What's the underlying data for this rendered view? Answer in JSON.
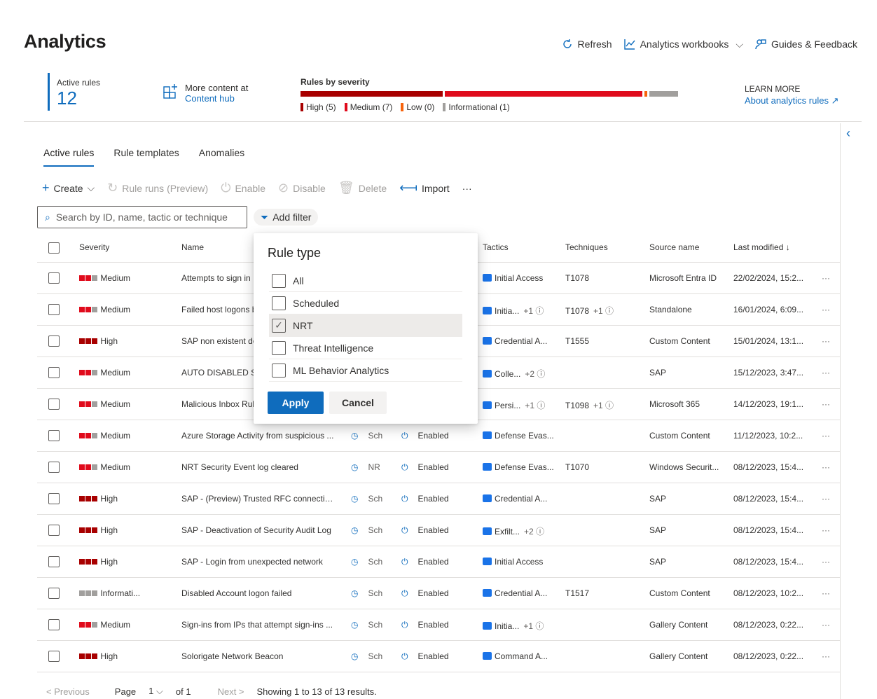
{
  "page": {
    "title": "Analytics"
  },
  "top_actions": {
    "refresh": "Refresh",
    "workbooks": "Analytics workbooks",
    "guides": "Guides & Feedback"
  },
  "summary": {
    "active_label": "Active rules",
    "active_count": "12",
    "content_line1": "More content at",
    "content_line2": "Content hub",
    "severity_label": "Rules by severity",
    "legend": {
      "high": "High (5)",
      "medium": "Medium (7)",
      "low": "Low (0)",
      "info": "Informational (1)"
    },
    "severity_counts": {
      "high": 5,
      "medium": 7,
      "low": 0,
      "informational": 1
    },
    "colors": {
      "high": "#a80000",
      "medium": "#e00b1c",
      "low": "#f7630c",
      "info": "#a19f9d"
    },
    "learn_more": "LEARN MORE",
    "learn_link": "About analytics rules"
  },
  "tabs": [
    "Active rules",
    "Rule templates",
    "Anomalies"
  ],
  "toolbar": {
    "create": "Create",
    "rule_runs": "Rule runs (Preview)",
    "enable": "Enable",
    "disable": "Disable",
    "delete": "Delete",
    "import": "Import",
    "more": "···"
  },
  "search": {
    "placeholder": "Search by ID, name, tactic or technique"
  },
  "filter": {
    "label": "Add filter"
  },
  "columns": {
    "severity": "Severity",
    "name": "Name",
    "tactics": "Tactics",
    "techniques": "Techniques",
    "source": "Source name",
    "modified": "Last modified ↓"
  },
  "rows": [
    {
      "sev": "Medium",
      "name": "Attempts to sign in",
      "rt": "",
      "st": "",
      "tac": "Initial Access",
      "tplus": "",
      "tec": "T1078",
      "teplus": "",
      "src": "Microsoft Entra ID",
      "mod": "22/02/2024, 15:2..."
    },
    {
      "sev": "Medium",
      "name": "Failed host logons b",
      "rt": "",
      "st": "",
      "tac": "Initia...",
      "tplus": "+1 ⓘ",
      "tec": "T1078",
      "teplus": "+1 ⓘ",
      "src": "Standalone",
      "mod": "16/01/2024, 6:09..."
    },
    {
      "sev": "High",
      "name": "SAP non existent de",
      "rt": "",
      "st": "",
      "tac": "Credential A...",
      "tplus": "",
      "tec": "T1555",
      "teplus": "",
      "src": "Custom Content",
      "mod": "15/01/2024, 13:1..."
    },
    {
      "sev": "Medium",
      "name": "AUTO DISABLED SA",
      "rt": "",
      "st": "",
      "tac": "Colle...",
      "tplus": "+2 ⓘ",
      "tec": "",
      "teplus": "",
      "src": "SAP",
      "mod": "15/12/2023, 3:47..."
    },
    {
      "sev": "Medium",
      "name": "Malicious Inbox Rul",
      "rt": "",
      "st": "",
      "tac": "Persi...",
      "tplus": "+1 ⓘ",
      "tec": "T1098",
      "teplus": "+1 ⓘ",
      "src": "Microsoft 365",
      "mod": "14/12/2023, 19:1..."
    },
    {
      "sev": "Medium",
      "name": "Azure Storage Activity from suspicious ...",
      "rt": "Sch",
      "st": "Enabled",
      "tac": "Defense Evas...",
      "tplus": "",
      "tec": "",
      "teplus": "",
      "src": "Custom Content",
      "mod": "11/12/2023, 10:2..."
    },
    {
      "sev": "Medium",
      "name": "NRT Security Event log cleared",
      "rt": "NR",
      "st": "Enabled",
      "tac": "Defense Evas...",
      "tplus": "",
      "tec": "T1070",
      "teplus": "",
      "src": "Windows Securit...",
      "mod": "08/12/2023, 15:4..."
    },
    {
      "sev": "High",
      "name": "SAP - (Preview) Trusted RFC connection...",
      "rt": "Sch",
      "st": "Enabled",
      "tac": "Credential A...",
      "tplus": "",
      "tec": "",
      "teplus": "",
      "src": "SAP",
      "mod": "08/12/2023, 15:4..."
    },
    {
      "sev": "High",
      "name": "SAP - Deactivation of Security Audit Log",
      "rt": "Sch",
      "st": "Enabled",
      "tac": "Exfilt...",
      "tplus": "+2 ⓘ",
      "tec": "",
      "teplus": "",
      "src": "SAP",
      "mod": "08/12/2023, 15:4..."
    },
    {
      "sev": "High",
      "name": "SAP - Login from unexpected network",
      "rt": "Sch",
      "st": "Enabled",
      "tac": "Initial Access",
      "tplus": "",
      "tec": "",
      "teplus": "",
      "src": "SAP",
      "mod": "08/12/2023, 15:4..."
    },
    {
      "sev": "Informati...",
      "name": "Disabled Account logon failed",
      "rt": "Sch",
      "st": "Enabled",
      "tac": "Credential A...",
      "tplus": "",
      "tec": "T1517",
      "teplus": "",
      "src": "Custom Content",
      "mod": "08/12/2023, 10:2..."
    },
    {
      "sev": "Medium",
      "name": "Sign-ins from IPs that attempt sign-ins ...",
      "rt": "Sch",
      "st": "Enabled",
      "tac": "Initia...",
      "tplus": "+1 ⓘ",
      "tec": "",
      "teplus": "",
      "src": "Gallery Content",
      "mod": "08/12/2023, 0:22..."
    },
    {
      "sev": "High",
      "name": "Solorigate Network Beacon",
      "rt": "Sch",
      "st": "Enabled",
      "tac": "Command A...",
      "tplus": "",
      "tec": "",
      "teplus": "",
      "src": "Gallery Content",
      "mod": "08/12/2023, 0:22..."
    }
  ],
  "pager": {
    "previous": "< Previous",
    "page": "Page",
    "page_num": "1",
    "of": "of 1",
    "next": "Next >",
    "showing": "Showing 1 to 13 of 13 results."
  },
  "dropdown": {
    "title": "Rule type",
    "options": [
      "All",
      "Scheduled",
      "NRT",
      "Threat Intelligence",
      "ML Behavior Analytics"
    ],
    "checked": "NRT",
    "apply": "Apply",
    "cancel": "Cancel"
  }
}
